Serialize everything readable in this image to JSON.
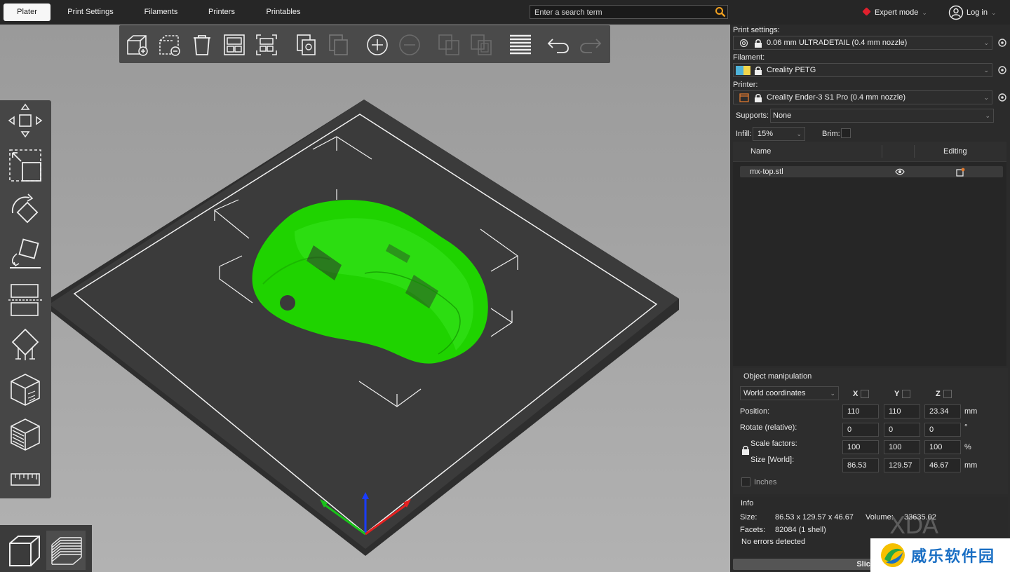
{
  "tabs": [
    {
      "label": "Plater",
      "active": true
    },
    {
      "label": "Print Settings",
      "active": false
    },
    {
      "label": "Filaments",
      "active": false
    },
    {
      "label": "Printers",
      "active": false
    },
    {
      "label": "Printables",
      "active": false
    }
  ],
  "search": {
    "placeholder": "Enter a search term"
  },
  "mode": {
    "label": "Expert mode",
    "color": "#e0202d"
  },
  "account": {
    "label": "Log in"
  },
  "panel": {
    "print_settings_label": "Print settings:",
    "print_settings_value": "0.06 mm ULTRADETAIL (0.4 mm nozzle)",
    "filament_label": "Filament:",
    "filament_value": "Creality PETG",
    "filament_colors": [
      "#4fb3d9",
      "#f2d64b"
    ],
    "printer_label": "Printer:",
    "printer_value": "Creality Ender-3 S1 Pro (0.4 mm nozzle)",
    "supports_label": "Supports:",
    "supports_value": "None",
    "infill_label": "Infill:",
    "infill_value": "15%",
    "brim_label": "Brim:"
  },
  "object_list": {
    "col_name": "Name",
    "col_editing": "Editing",
    "objects": [
      {
        "name": "mx-top.stl"
      }
    ]
  },
  "object_manipulation": {
    "title": "Object manipulation",
    "coord_system": "World coordinates",
    "axes": [
      "X",
      "Y",
      "Z"
    ],
    "position_label": "Position:",
    "position": [
      "110",
      "110",
      "23.34"
    ],
    "position_unit": "mm",
    "rotate_label": "Rotate (relative):",
    "rotate": [
      "0",
      "0",
      "0"
    ],
    "rotate_unit": "°",
    "scale_label": "Scale factors:",
    "scale": [
      "100",
      "100",
      "100"
    ],
    "scale_unit": "%",
    "size_label": "Size [World]:",
    "size": [
      "86.53",
      "129.57",
      "46.67"
    ],
    "size_unit": "mm",
    "inches_label": "Inches"
  },
  "info": {
    "title": "Info",
    "size_label": "Size:",
    "size_value": "86.53 x 129.57 x 46.67",
    "volume_label": "Volume:",
    "volume_value": "33635.02",
    "facets_label": "Facets:",
    "facets_value": "82084 (1 shell)",
    "errors": "No errors detected"
  },
  "slice_button": "Slice",
  "watermark": {
    "xda": "XDA",
    "site": "威乐软件园"
  },
  "colors": {
    "model": "#22dd00",
    "bed": "#3a3a3a",
    "accent": "#e0202d"
  }
}
